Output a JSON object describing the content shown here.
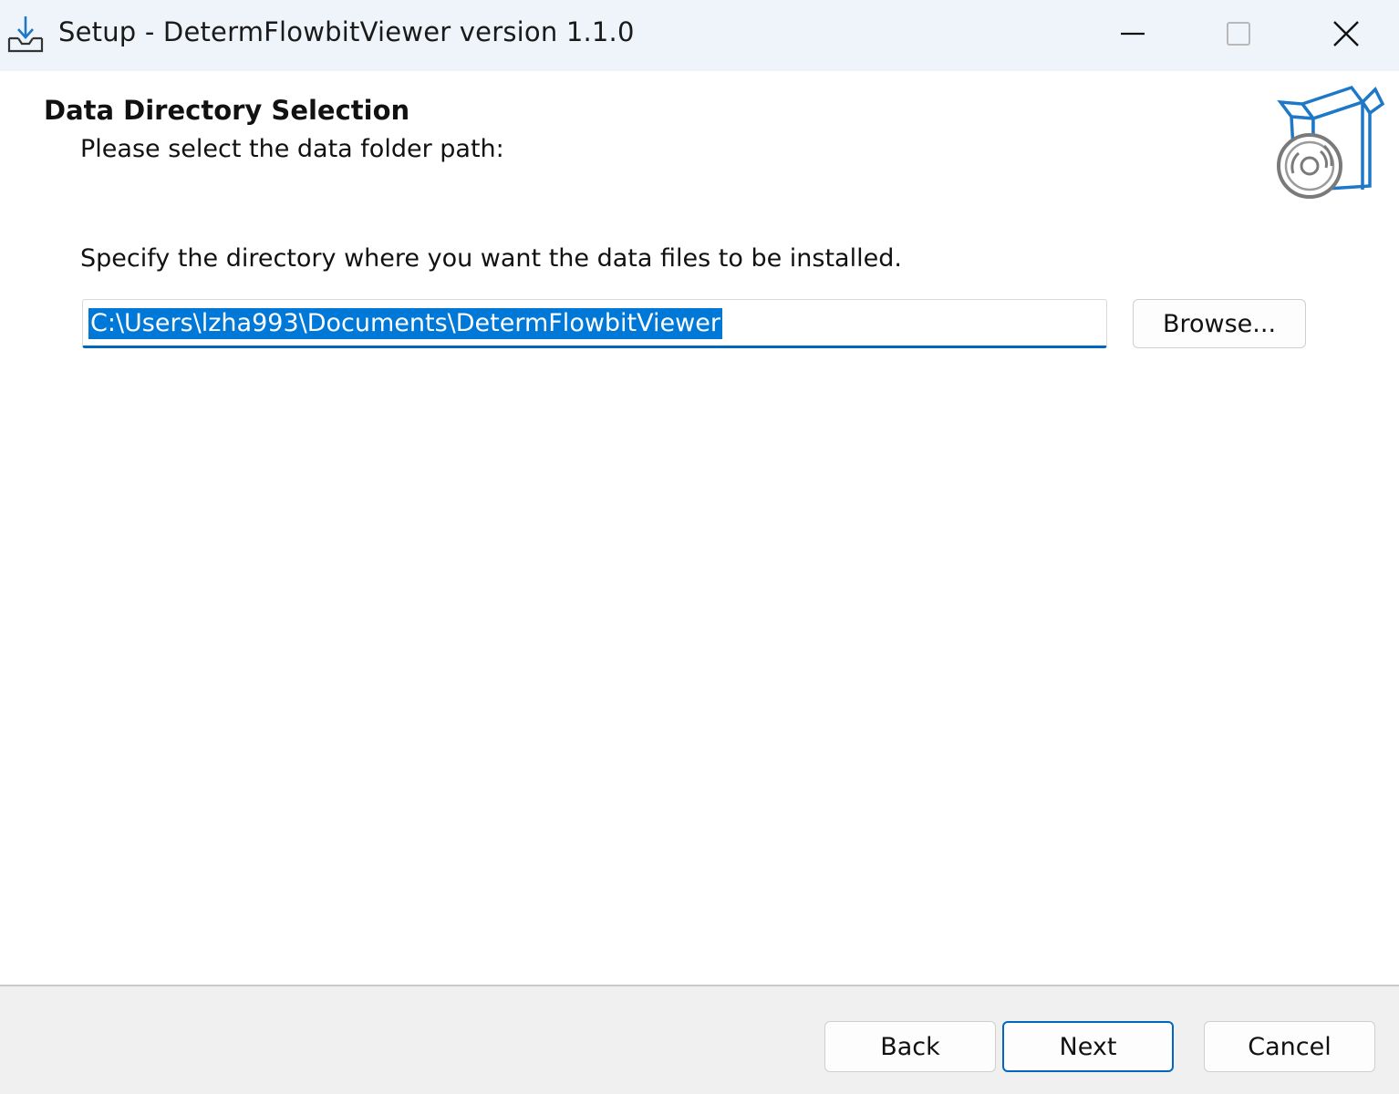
{
  "window": {
    "title": "Setup - DetermFlowbitViewer version 1.1.0",
    "app_icon": "download-tray-icon",
    "controls": {
      "minimize": "minimize-icon",
      "maximize": "maximize-icon",
      "close": "close-icon"
    }
  },
  "page": {
    "title": "Data Directory Selection",
    "subtitle": "Please select the data folder path:",
    "header_graphic": "installer-box-disc-icon",
    "instruction": "Specify the directory where you want the data files to be installed.",
    "path_value": "C:\\Users\\lzha993\\Documents\\DetermFlowbitViewer",
    "browse_label": "Browse..."
  },
  "footer": {
    "back_label": "Back",
    "next_label": "Next",
    "cancel_label": "Cancel"
  },
  "colors": {
    "accent": "#0067c0",
    "selection": "#0078d7",
    "titlebar": "#eef4f9",
    "footer": "#f0f0f0"
  }
}
